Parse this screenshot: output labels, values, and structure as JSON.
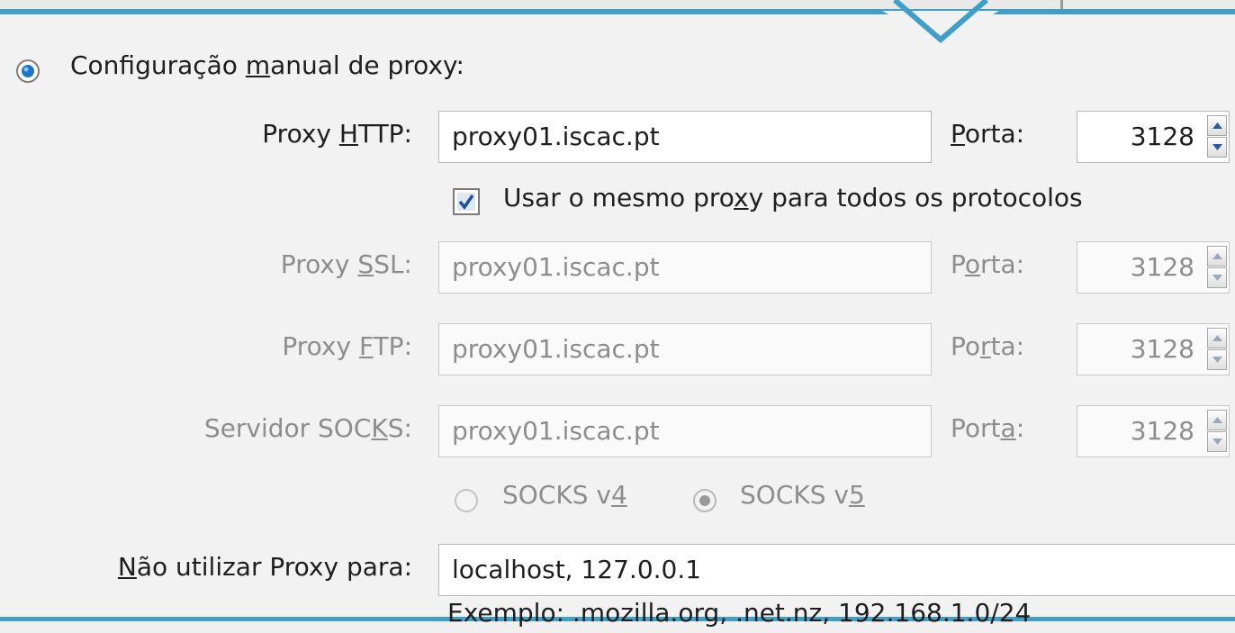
{
  "manual_proxy": {
    "label_before": "Configuração ",
    "label_underline": "m",
    "label_after": "anual de proxy:",
    "selected": true
  },
  "http": {
    "label_before": "Proxy ",
    "label_underline": "H",
    "label_after": "TTP:",
    "value": "proxy01.iscac.pt",
    "port_label_before": "",
    "port_label_underline": "P",
    "port_label_after": "orta:",
    "port": "3128"
  },
  "same_proxy": {
    "label_before": "Usar o mesmo pro",
    "label_underline": "x",
    "label_after": "y para todos os protocolos",
    "checked": true
  },
  "ssl": {
    "label_before": "Proxy ",
    "label_underline": "S",
    "label_after": "SL:",
    "value": "proxy01.iscac.pt",
    "port_label_before": "P",
    "port_label_underline": "o",
    "port_label_after": "rta:",
    "port": "3128"
  },
  "ftp": {
    "label_before": "Proxy ",
    "label_underline": "F",
    "label_after": "TP:",
    "value": "proxy01.iscac.pt",
    "port_label_before": "Po",
    "port_label_underline": "r",
    "port_label_after": "ta:",
    "port": "3128"
  },
  "socks": {
    "label_before": "Servidor SOC",
    "label_underline": "K",
    "label_after": "S:",
    "value": "proxy01.iscac.pt",
    "port_label_before": "Port",
    "port_label_underline": "a",
    "port_label_after": ":",
    "port": "3128",
    "v4_before": "SOCKS v",
    "v4_underline": "4",
    "v5_before": "SOCKS v",
    "v5_underline": "5",
    "selected_version": "v5"
  },
  "no_proxy": {
    "label_underline": "N",
    "label_after": "ão utilizar Proxy para:",
    "value": "localhost, 127.0.0.1",
    "example": "Exemplo: .mozilla.org, .net.nz, 192.168.1.0/24"
  },
  "colors": {
    "accent": "#3f9fc9",
    "disabled_text": "#8d8d8d",
    "radio_selected": "#1f74c9"
  }
}
